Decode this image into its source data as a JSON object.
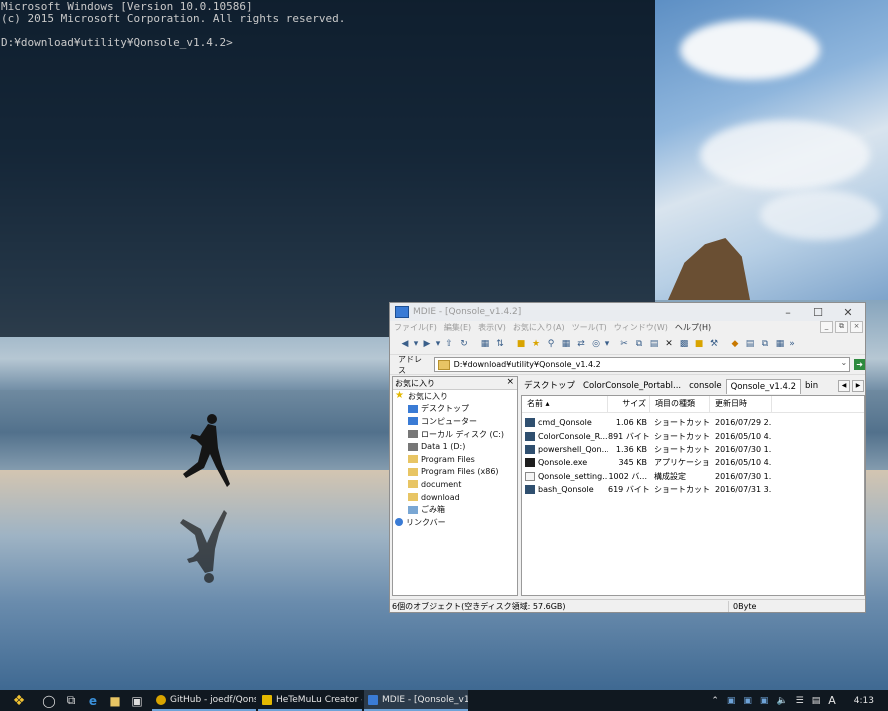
{
  "console": {
    "lines": [
      "Microsoft Windows [Version 10.0.10586]",
      "(c) 2015 Microsoft Corporation. All rights reserved.",
      "",
      "D:¥download¥utility¥Qonsole_v1.4.2>"
    ]
  },
  "explorer": {
    "title": "MDIE - [Qonsole_v1.4.2]",
    "menu": [
      "ファイル(F)",
      "編集(E)",
      "表示(V)",
      "お気に入り(A)",
      "ツール(T)",
      "ウィンドウ(W)",
      "ヘルプ(H)"
    ],
    "address_label": "アドレス",
    "address_value": "D:¥download¥utility¥Qonsole_v1.4.2",
    "sidebar_title": "お気に入り",
    "tree": [
      {
        "label": "お気に入り",
        "indent": 0,
        "icon": "star-icon"
      },
      {
        "label": "デスクトップ",
        "indent": 1,
        "icon": "desktop-icon"
      },
      {
        "label": "コンピューター",
        "indent": 1,
        "icon": "computer-icon"
      },
      {
        "label": "ローカル ディスク (C:)",
        "indent": 1,
        "icon": "drive-icon"
      },
      {
        "label": "Data 1 (D:)",
        "indent": 1,
        "icon": "drive-icon"
      },
      {
        "label": "Program Files",
        "indent": 1,
        "icon": "folder-icon"
      },
      {
        "label": "Program Files (x86)",
        "indent": 1,
        "icon": "folder-icon"
      },
      {
        "label": "document",
        "indent": 1,
        "icon": "folder-icon"
      },
      {
        "label": "download",
        "indent": 1,
        "icon": "folder-icon"
      },
      {
        "label": "ごみ箱",
        "indent": 1,
        "icon": "recycle-bin-icon"
      },
      {
        "label": "リンクバー",
        "indent": 0,
        "icon": "link-icon"
      }
    ],
    "tabs": [
      "デスクトップ",
      "ColorConsole_Portabl...",
      "console",
      "Qonsole_v1.4.2",
      "bin"
    ],
    "active_tab": 3,
    "columns": [
      "名前",
      "サイズ",
      "項目の種類",
      "更新日時"
    ],
    "files": [
      {
        "name": "cmd_Qonsole",
        "size": "1.06 KB",
        "type": "ショートカット",
        "date": "2016/07/29 2...",
        "icon": "shortcut-icon"
      },
      {
        "name": "ColorConsole_R...",
        "size": "891 バイト",
        "type": "ショートカット",
        "date": "2016/05/10 4...",
        "icon": "shortcut-icon"
      },
      {
        "name": "powershell_Qon...",
        "size": "1.36 KB",
        "type": "ショートカット",
        "date": "2016/07/30 1...",
        "icon": "shortcut-icon"
      },
      {
        "name": "Qonsole.exe",
        "size": "345 KB",
        "type": "アプリケーション",
        "date": "2016/05/10 4...",
        "icon": "exe-icon"
      },
      {
        "name": "Qonsole_setting...",
        "size": "1002 バ...",
        "type": "構成設定",
        "date": "2016/07/30 1...",
        "icon": "config-file-icon"
      },
      {
        "name": "bash_Qonsole",
        "size": "619 バイト",
        "type": "ショートカット",
        "date": "2016/07/31 3...",
        "icon": "shortcut-icon"
      }
    ],
    "status_left": "6個のオブジェクト(空きディスク領域: 57.6GB)",
    "status_right": "0Byte"
  },
  "taskbar": {
    "apps": [
      {
        "label": "GitHub - joedf/Qons...",
        "icon": "chrome-icon",
        "color": "#d9a400"
      },
      {
        "label": "HeTeMuLu Creator - ...",
        "icon": "hetemulu-icon",
        "color": "#e3b800"
      },
      {
        "label": "MDIE - [Qonsole_v1.4...",
        "icon": "mdie-icon",
        "color": "#3a7bd5"
      }
    ],
    "ime": "A",
    "time": "4:13"
  },
  "colors": {
    "accent": "#6ea3d8",
    "console_bg": "#0a1826",
    "taskbar_bg": "#101820"
  }
}
